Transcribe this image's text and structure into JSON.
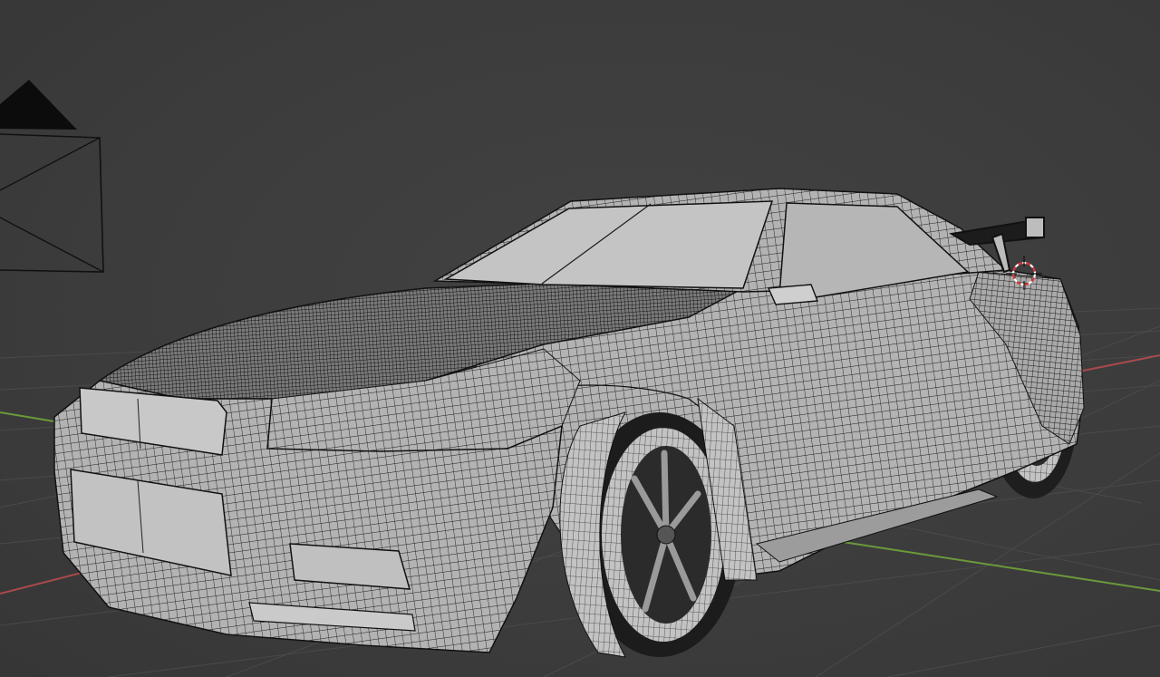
{
  "viewport": {
    "mode": "3d-viewport-wireframe-solid",
    "objects": [
      "camera",
      "car-body",
      "front-wheel",
      "rear-wheel",
      "side-mirror",
      "rear-spoiler",
      "3d-cursor"
    ],
    "colors": {
      "background": "#3d3d3d",
      "grid": "#4a4a4a",
      "x_axis": "#a84a4a",
      "y_axis": "#6a9a3a",
      "mesh_fill": "#b9b9b9",
      "mesh_wire": "#1a1a1a",
      "glass": "#c4c4c4",
      "camera": "#101010",
      "cursor_red": "#d8363a"
    }
  }
}
